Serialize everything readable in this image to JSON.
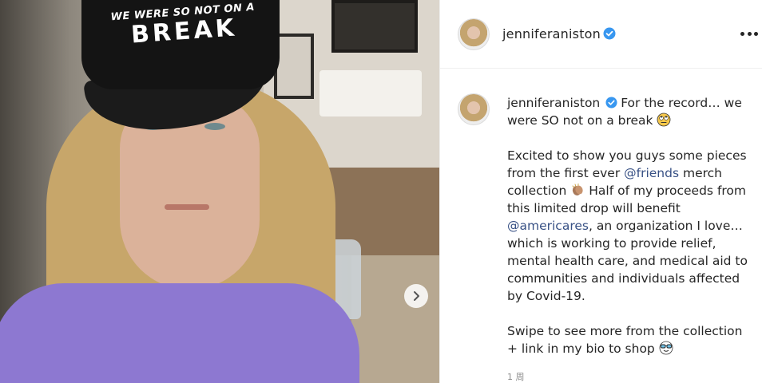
{
  "post": {
    "media": {
      "cap_text_line1": "WE WERE SO NOT ON A",
      "cap_text_line2": "BREAK"
    },
    "header": {
      "username": "jenniferaniston"
    },
    "caption": {
      "username": "jenniferaniston",
      "line1": "For the record… we were SO not on a break",
      "para2_part1": "Excited to show you guys some pieces from the first ever ",
      "mention1": "@friends",
      "para2_part2": " merch collection",
      "para2_part3": " Half of my proceeds from this limited drop will benefit ",
      "mention2": "@americares",
      "para2_part4": ", an organization I love… which is working to provide relief, mental health care, and medical aid to communities and individuals affected by Covid-19.",
      "para3": "Swipe to see more from the collection + link in my bio to shop"
    },
    "timeago": "1 周"
  },
  "colors": {
    "verified_blue": "#3897f0",
    "mention_blue": "#385185",
    "text": "#262626",
    "meta_gray": "#8e8e8e"
  },
  "icons": {
    "verified": "verified-badge-icon",
    "more": "more-options-icon",
    "next": "chevron-right-icon",
    "emoji1": "rolling-eyes-emoji",
    "emoji2": "clapping-hands-emoji",
    "emoji3": "sunglasses-emoji"
  }
}
